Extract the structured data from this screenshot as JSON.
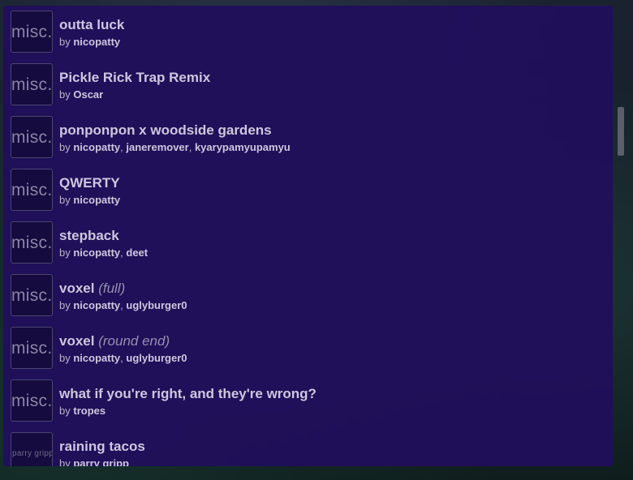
{
  "songs": [
    {
      "thumb": "misc.",
      "title": "outta luck",
      "subtitle": "",
      "by": "by",
      "artists": [
        "nicopatty"
      ]
    },
    {
      "thumb": "misc.",
      "title": "Pickle Rick Trap Remix",
      "subtitle": "",
      "by": "by",
      "artists": [
        "Oscar"
      ]
    },
    {
      "thumb": "misc.",
      "title": "ponponpon x woodside gardens",
      "subtitle": "",
      "by": "by",
      "artists": [
        "nicopatty",
        "janeremover",
        "kyarypamyupamyu"
      ]
    },
    {
      "thumb": "misc.",
      "title": "QWERTY",
      "subtitle": "",
      "by": "by",
      "artists": [
        "nicopatty"
      ]
    },
    {
      "thumb": "misc.",
      "title": "stepback",
      "subtitle": "",
      "by": "by",
      "artists": [
        "nicopatty",
        "deet"
      ]
    },
    {
      "thumb": "misc.",
      "title": "voxel",
      "subtitle": "(full)",
      "by": "by",
      "artists": [
        "nicopatty",
        "uglyburger0"
      ]
    },
    {
      "thumb": "misc.",
      "title": "voxel",
      "subtitle": "(round end)",
      "by": "by",
      "artists": [
        "nicopatty",
        "uglyburger0"
      ]
    },
    {
      "thumb": "misc.",
      "title": "what if you're right, and they're wrong?",
      "subtitle": "",
      "by": "by",
      "artists": [
        "tropes"
      ]
    },
    {
      "thumb": "parry gripp",
      "title": "raining tacos",
      "subtitle": "",
      "by": "by",
      "artists": [
        "parry gripp"
      ]
    }
  ],
  "separator": ", "
}
